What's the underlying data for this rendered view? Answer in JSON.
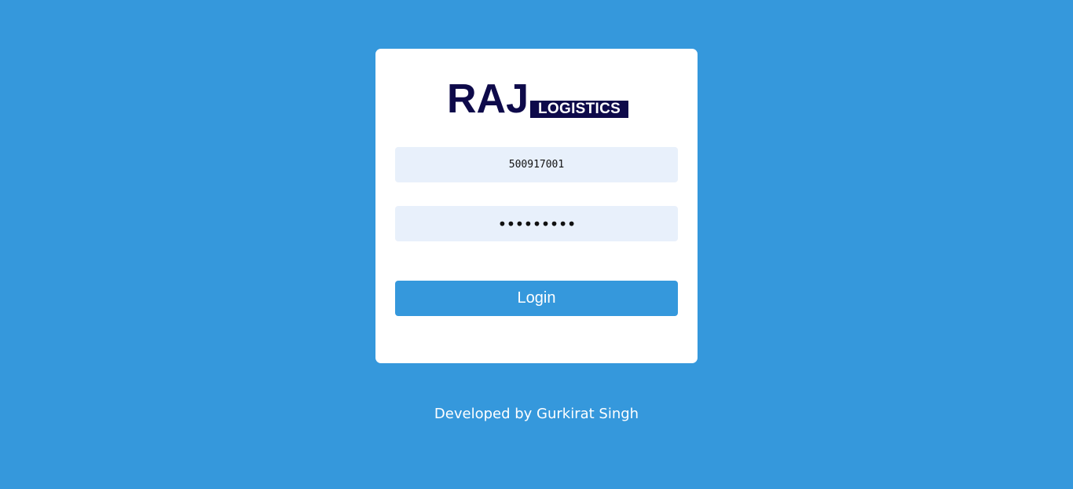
{
  "brand": {
    "main": "RAJ",
    "sub": "LOGISTICS",
    "color": "#0e0a4a"
  },
  "form": {
    "username_value": "500917001",
    "password_value": "asdfghjkl",
    "login_label": "Login"
  },
  "footer": {
    "text": "Developed by Gurkirat Singh"
  },
  "colors": {
    "background": "#3598dc",
    "card": "#ffffff",
    "input_bg": "#e8f0fb",
    "button": "#3598dc"
  }
}
